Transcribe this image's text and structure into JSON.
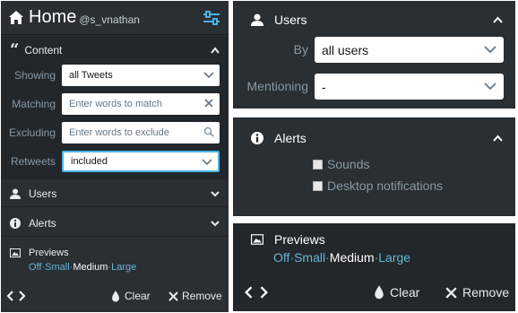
{
  "header": {
    "title": "Home",
    "handle": "@s_vnathan"
  },
  "content": {
    "title": "Content",
    "showing": {
      "label": "Showing",
      "value": "all Tweets"
    },
    "matching": {
      "label": "Matching",
      "placeholder": "Enter words to match"
    },
    "excluding": {
      "label": "Excluding",
      "placeholder": "Enter words to exclude"
    },
    "retweets": {
      "label": "Retweets",
      "value": "included"
    }
  },
  "users_row": {
    "label": "Users"
  },
  "alerts_row": {
    "label": "Alerts"
  },
  "previews": {
    "label": "Previews",
    "options": [
      "Off",
      "Small",
      "Medium",
      "Large"
    ],
    "selected": "Medium",
    "sep": "·"
  },
  "footer": {
    "clear": "Clear",
    "remove": "Remove"
  },
  "users_panel": {
    "title": "Users",
    "by": {
      "label": "By",
      "value": "all users"
    },
    "mentioning": {
      "label": "Mentioning",
      "value": "-"
    }
  },
  "alerts_panel": {
    "title": "Alerts",
    "options": [
      "Sounds",
      "Desktop notifications"
    ]
  },
  "icons": {
    "home": "home-icon",
    "settings": "sliders-icon",
    "quote": "quote-icon",
    "user": "user-icon",
    "info": "info-icon",
    "image": "image-icon",
    "drop": "drop-icon",
    "close": "close-icon",
    "chevron": "chevron-icon",
    "search": "search-icon"
  },
  "colors": {
    "panel": "#292f33",
    "section": "#22272b",
    "link": "#66b5d2",
    "accent": "#1da1f2"
  }
}
